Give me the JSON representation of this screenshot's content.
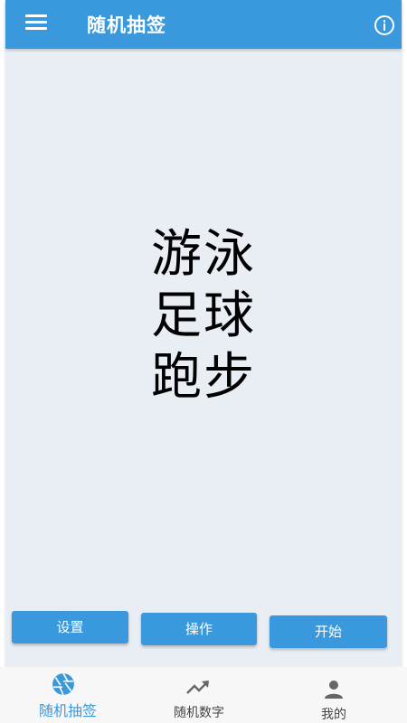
{
  "app": {
    "title": "随机抽签"
  },
  "header": {
    "menu_icon": "hamburger-menu-icon",
    "info_icon": "info-icon"
  },
  "draw": {
    "items": [
      "游泳",
      "足球",
      "跑步"
    ]
  },
  "actions": {
    "settings_label": "设置",
    "operate_label": "操作",
    "start_label": "开始"
  },
  "bottom_nav": {
    "items": [
      {
        "label": "随机抽签",
        "icon": "aperture-icon",
        "active": true
      },
      {
        "label": "随机数字",
        "icon": "trending-up-icon",
        "active": false
      },
      {
        "label": "我的",
        "icon": "person-icon",
        "active": false
      }
    ]
  },
  "colors": {
    "primary": "#3a98dc",
    "background": "#e9eef5",
    "nav_background": "#f7f7f7"
  }
}
